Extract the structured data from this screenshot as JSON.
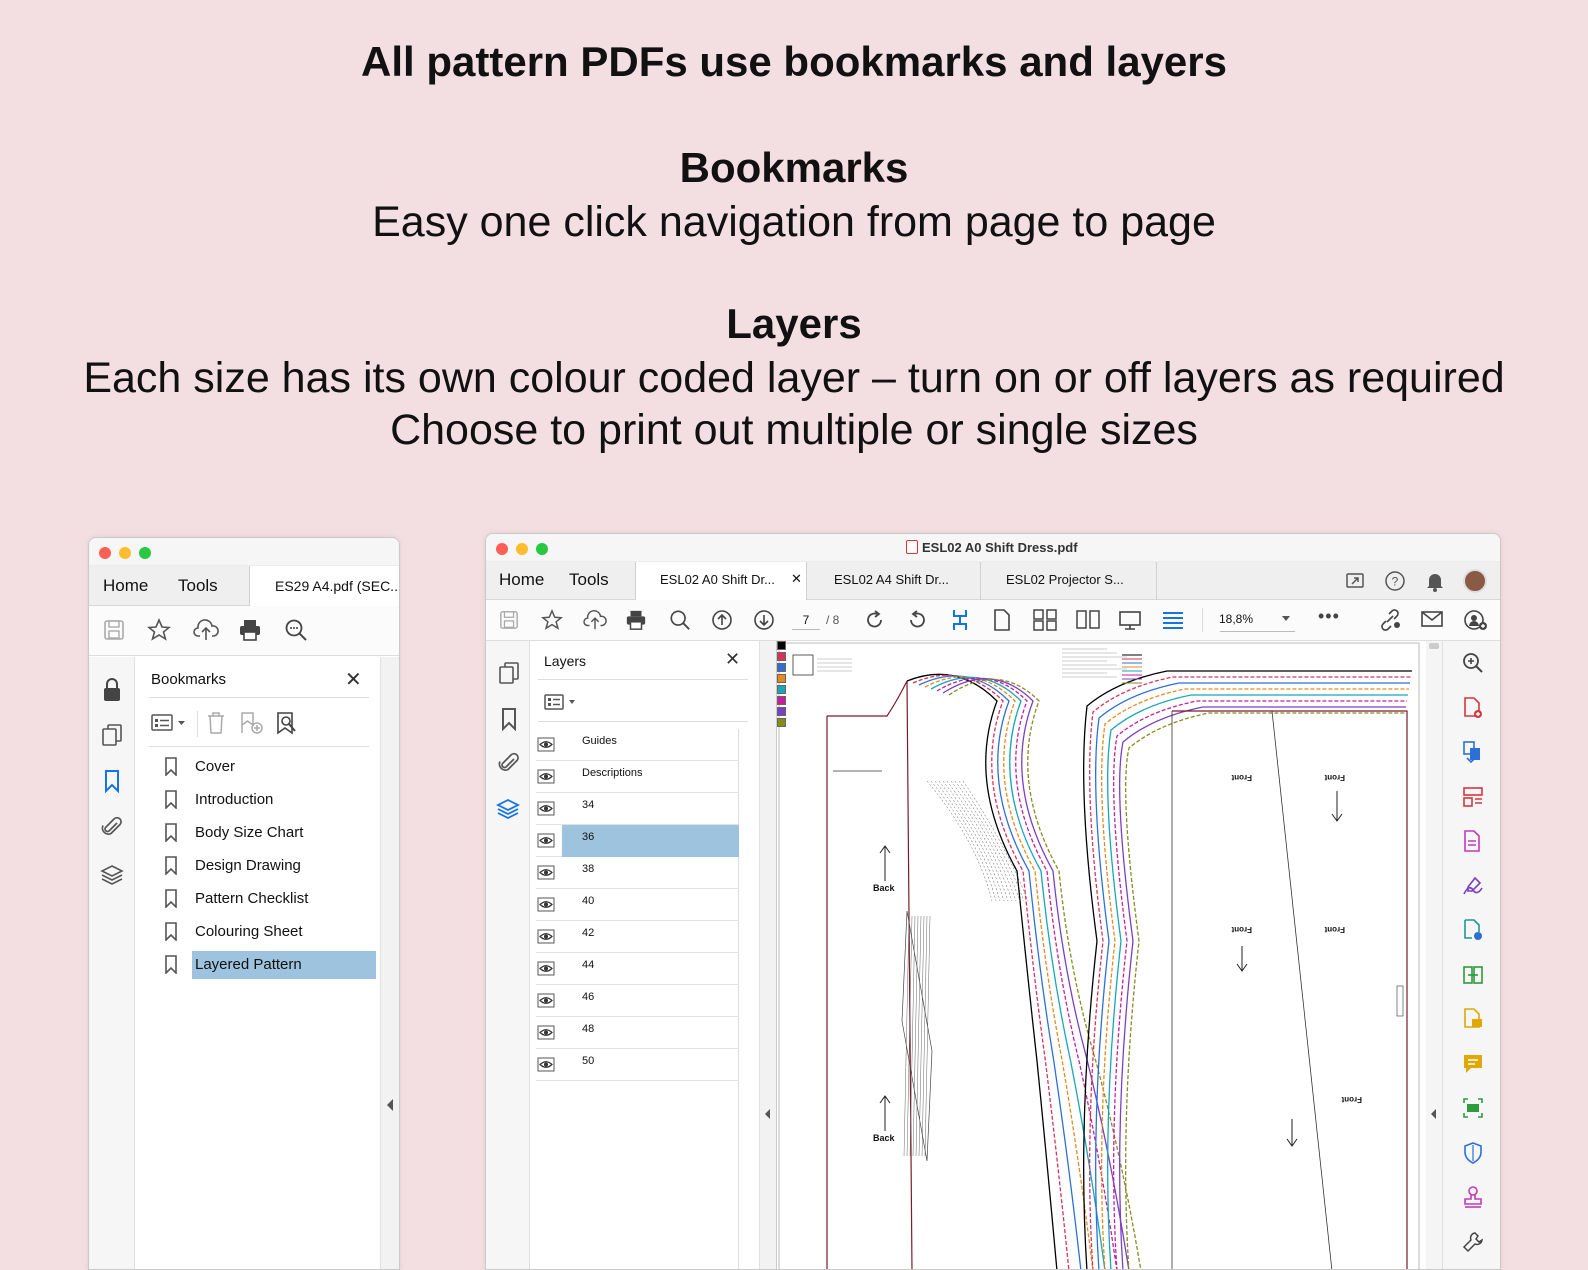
{
  "hero": {
    "headline": "All pattern PDFs use bookmarks and layers",
    "bookmarks_title": "Bookmarks",
    "bookmarks_text": "Easy one click navigation from page to page",
    "layers_title": "Layers",
    "layers_text_1": "Each size has its own colour coded layer – turn on or off layers as required",
    "layers_text_2": "Choose to print out multiple or single sizes"
  },
  "left_window": {
    "tabs": {
      "home": "Home",
      "tools": "Tools",
      "document": "ES29 A4.pdf (SEC..."
    },
    "panel_title": "Bookmarks",
    "bookmarks": [
      "Cover",
      "Introduction",
      "Body Size Chart",
      "Design Drawing",
      "Pattern Checklist",
      "Colouring Sheet",
      "Layered Pattern"
    ],
    "selected_bookmark": "Layered Pattern"
  },
  "right_window": {
    "title": "ESL02 A0 Shift Dress.pdf",
    "tabs": {
      "home": "Home",
      "tools": "Tools",
      "doc1": "ESL02 A0 Shift Dr...",
      "doc2": "ESL02 A4 Shift Dr...",
      "doc3": "ESL02 Projector S..."
    },
    "page_current": "7",
    "page_total": "/ 8",
    "zoom": "18,8%",
    "panel_title": "Layers",
    "layers": [
      "Guides",
      "Descriptions",
      "34",
      "36",
      "38",
      "40",
      "42",
      "44",
      "46",
      "48",
      "50"
    ],
    "selected_layer": "36",
    "pattern_labels": {
      "back": "Back",
      "front": "Front"
    },
    "size_colors": [
      "#000000",
      "#d9325a",
      "#2f6fd6",
      "#e58a1f",
      "#18a6b8",
      "#c81e9e",
      "#7c3fc4",
      "#8a8a20"
    ]
  }
}
